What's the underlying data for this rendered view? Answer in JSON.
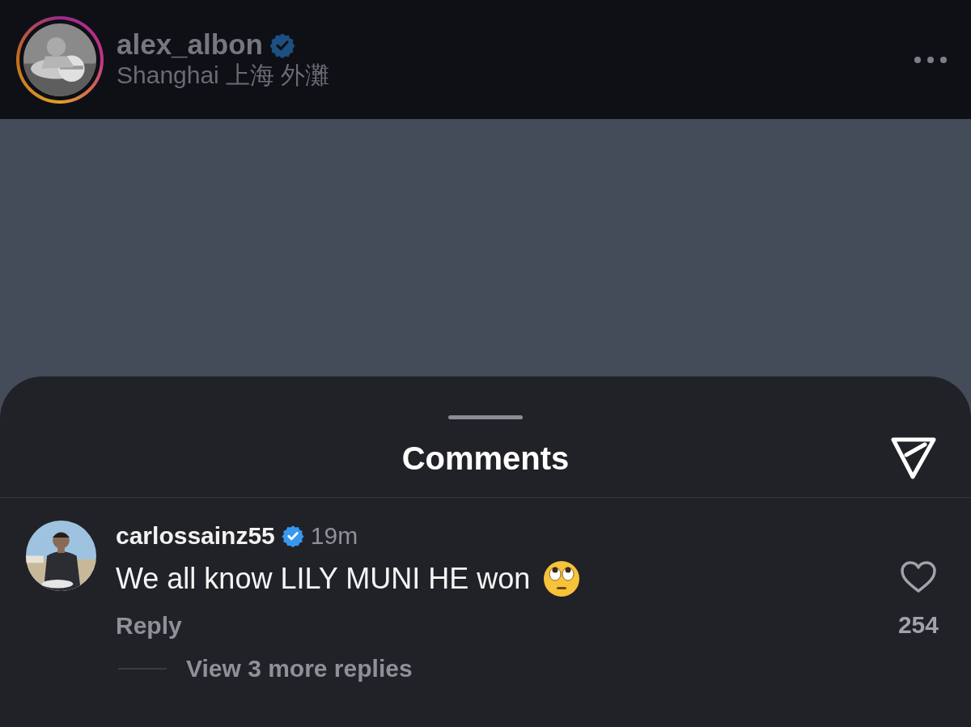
{
  "post_header": {
    "username": "alex_albon",
    "verified": true,
    "location": "Shanghai 上海 外灘",
    "has_story": true
  },
  "sheet": {
    "title": "Comments"
  },
  "comments": [
    {
      "username": "carlossainz55",
      "verified": true,
      "time": "19m",
      "text": "We all know LILY MUNI HE won",
      "reply_label": "Reply",
      "liked": false,
      "likes": "254",
      "view_replies": "View 3 more replies"
    }
  ]
}
